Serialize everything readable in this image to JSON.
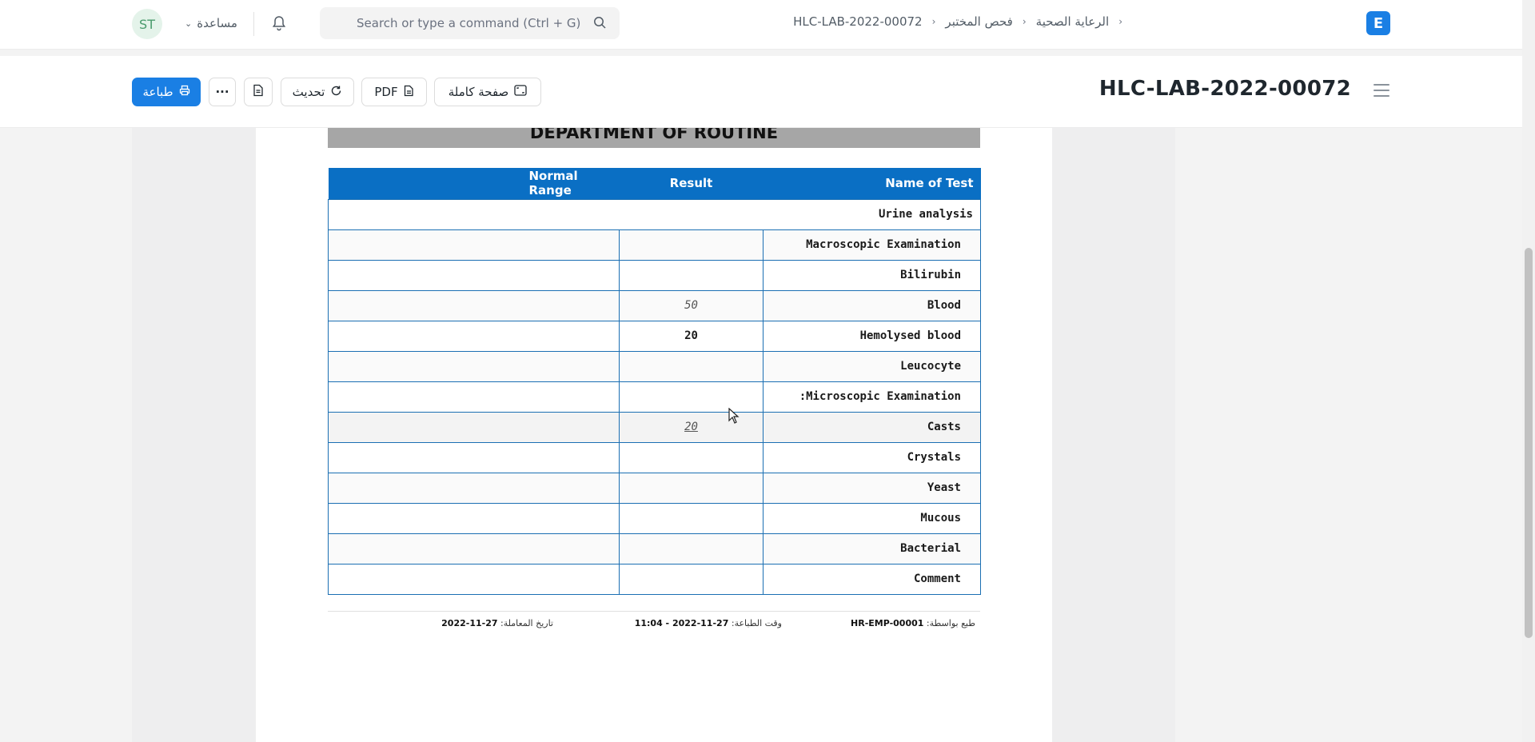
{
  "navbar": {
    "avatar_initials": "ST",
    "help_label": "مساعدة",
    "search_placeholder": "Search or type a command (Ctrl + G)",
    "breadcrumbs": [
      "الرعاية الصحية",
      "فحص المختبر",
      "HLC-LAB-2022-00072"
    ],
    "logo_letter": "E",
    "accent_color": "#1a7fe4"
  },
  "header": {
    "title": "HLC-LAB-2022-00072",
    "print_label": "طباعة",
    "more_label": "···",
    "refresh_label": "تحديث",
    "pdf_label": "PDF",
    "fullpage_label": "صفحة كاملة"
  },
  "report": {
    "department_title": "DEPARTMENT OF ROUTINE",
    "columns": [
      "Name of Test",
      "Result",
      "Normal Range"
    ],
    "section": "Urine analysis",
    "rows": [
      {
        "name": "Macroscopic Examination",
        "result": "",
        "range": ""
      },
      {
        "name": "Bilirubin",
        "result": "",
        "range": ""
      },
      {
        "name": "Blood",
        "result": "50",
        "range": ""
      },
      {
        "name": "Hemolysed blood",
        "result": "20",
        "range": ""
      },
      {
        "name": "Leucocyte",
        "result": "",
        "range": ""
      },
      {
        "name": "Microscopic Examination:",
        "result": "",
        "range": ""
      },
      {
        "name": "Casts",
        "result": "20",
        "range": ""
      },
      {
        "name": "Crystals",
        "result": "",
        "range": ""
      },
      {
        "name": "Yeast",
        "result": "",
        "range": ""
      },
      {
        "name": "Mucous",
        "result": "",
        "range": ""
      },
      {
        "name": "Bacterial",
        "result": "",
        "range": ""
      },
      {
        "name": "Comment",
        "result": "",
        "range": ""
      }
    ],
    "footer": {
      "printed_by_label": "طبع بواسطة:",
      "printed_by": "HR-EMP-00001",
      "print_time_label": "وقت الطباعة:",
      "print_time": "27-11-2022 - 11:04",
      "transaction_date_label": "تاريخ المعاملة:",
      "transaction_date": "27-11-2022"
    }
  }
}
